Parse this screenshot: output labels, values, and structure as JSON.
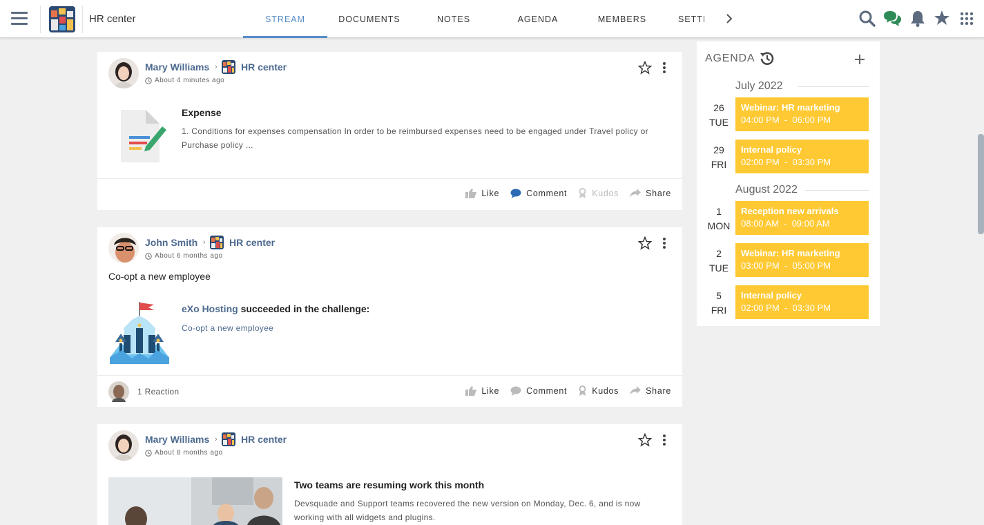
{
  "header": {
    "space_name": "HR center",
    "tabs": [
      "STREAM",
      "DOCUMENTS",
      "NOTES",
      "AGENDA",
      "MEMBERS",
      "SETTI"
    ],
    "active_tab": "STREAM",
    "icons": [
      "search-icon",
      "chat-icon",
      "bell-icon",
      "star-icon",
      "apps-grid-icon"
    ]
  },
  "posts": [
    {
      "author": "Mary Williams",
      "space": "HR center",
      "time": "About 4 minutes ago",
      "title": "Expense",
      "summary_line1": "1. Conditions for expenses compensation In order to be reimbursed expenses need to be engaged under Travel policy or",
      "summary_line2": "Purchase policy ...",
      "actions": {
        "like": "Like",
        "comment": "Comment",
        "kudos": "Kudos",
        "share": "Share"
      }
    },
    {
      "author": "John Smith",
      "space": "HR center",
      "time": "About 6 months ago",
      "text": "Co-opt a new employee",
      "challenge_user": "eXo Hosting",
      "challenge_text": "succeeded in the challenge:",
      "challenge_name": "Co-opt a new employee",
      "reactions": "1 Reaction",
      "actions": {
        "like": "Like",
        "comment": "Comment",
        "kudos": "Kudos",
        "share": "Share"
      }
    },
    {
      "author": "Mary Williams",
      "space": "HR center",
      "time": "About 8 months ago",
      "title": "Two teams are resuming work this month",
      "summary_line1": "Devsquade and Support teams recovered the new version on Monday, Dec. 6, and is now",
      "summary_line2": "working with all widgets and plugins."
    }
  ],
  "agenda": {
    "title": "AGENDA",
    "months": [
      "July 2022",
      "August 2022"
    ],
    "events": [
      {
        "day": "26",
        "weekday": "TUE",
        "name": "Webinar: HR marketing",
        "time": "04:00 PM  -  06:00 PM"
      },
      {
        "day": "29",
        "weekday": "FRI",
        "name": "Internal policy",
        "time": "02:00 PM  -  03:30 PM"
      },
      {
        "day": "1",
        "weekday": "MON",
        "name": "Reception new arrivals",
        "time": "08:00 AM  -  09:00 AM"
      },
      {
        "day": "2",
        "weekday": "TUE",
        "name": "Webinar: HR marketing",
        "time": "03:00 PM  -  05:00 PM"
      },
      {
        "day": "5",
        "weekday": "FRI",
        "name": "Internal policy",
        "time": "02:00 PM  -  03:30 PM"
      }
    ],
    "event_color": "#ffc933"
  },
  "colors": {
    "accent": "#578dc9",
    "link": "#4d6a8f",
    "background": "#f0f0f0"
  }
}
